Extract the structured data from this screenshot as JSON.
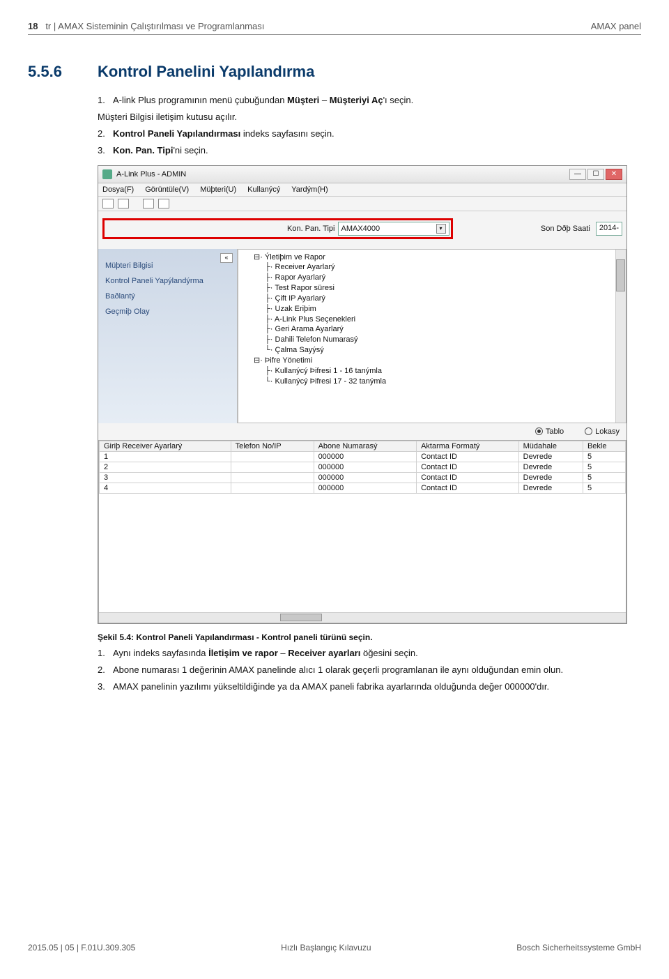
{
  "header": {
    "page_num": "18",
    "left_lang": "tr",
    "left_title": "AMAX Sisteminin Çalıştırılması ve Programlanması",
    "right": "AMAX panel"
  },
  "section": {
    "num": "5.5.6",
    "title": "Kontrol Panelini Yapılandırma",
    "steps_a": [
      {
        "n": "1.",
        "pre": "A-link Plus programının menü çubuğundan ",
        "bold": "Müşteri",
        "mid": " – ",
        "bold2": "Müşteriyi Aç",
        "post": "'ı seçin."
      },
      {
        "n": "",
        "pre": "Müşteri Bilgisi iletişim kutusu açılır.",
        "bold": "",
        "mid": "",
        "bold2": "",
        "post": ""
      },
      {
        "n": "2.",
        "pre": "",
        "bold": "Kontrol Paneli Yapılandırması",
        "mid": " indeks sayfasını seçin.",
        "bold2": "",
        "post": ""
      },
      {
        "n": "3.",
        "pre": "",
        "bold": "Kon. Pan. Tipi",
        "mid": "'ni seçin.",
        "bold2": "",
        "post": ""
      }
    ],
    "caption": "Şekil 5.4: Kontrol Paneli Yapılandırması - Kontrol paneli türünü seçin.",
    "steps_b": [
      {
        "n": "1.",
        "pre": "Aynı indeks sayfasında ",
        "bold": "İletişim ve rapor",
        "mid": " – ",
        "bold2": "Receiver ayarları",
        "post": " öğesini seçin."
      },
      {
        "n": "2.",
        "pre": "Abone numarası 1 değerinin AMAX panelinde alıcı 1 olarak geçerli programlanan ile aynı olduğundan emin olun.",
        "bold": "",
        "mid": "",
        "bold2": "",
        "post": ""
      },
      {
        "n": "3.",
        "pre": "AMAX panelinin yazılımı yükseltildiğinde ya da AMAX paneli fabrika ayarlarında olduğunda değer 000000'dır.",
        "bold": "",
        "mid": "",
        "bold2": "",
        "post": ""
      }
    ]
  },
  "app": {
    "title": "A-Link Plus - ADMIN",
    "menus": [
      "Dosya(F)",
      "Görüntüle(V)",
      "Müþteri(U)",
      "Kullanýcý",
      "Yardým(H)"
    ],
    "toprow": {
      "label": "Kon. Pan. Tipi",
      "combo_value": "AMAX4000",
      "right_label": "Son Dðþ Saati",
      "date": "2014-"
    },
    "sidebar": [
      "Müþteri Bilgisi",
      "Kontrol Paneli Yapýlandýrma",
      "Baðlantý",
      "Geçmiþ Olay"
    ],
    "tree": [
      {
        "lvl": 0,
        "prefix": "⊟·",
        "label": "Ýletiþim ve Rapor"
      },
      {
        "lvl": 1,
        "prefix": "├·",
        "label": "Receiver Ayarlarý"
      },
      {
        "lvl": 1,
        "prefix": "├·",
        "label": "Rapor Ayarlarý"
      },
      {
        "lvl": 1,
        "prefix": "├·",
        "label": "Test Rapor süresi"
      },
      {
        "lvl": 1,
        "prefix": "├·",
        "label": "Çift IP Ayarlarý"
      },
      {
        "lvl": 1,
        "prefix": "├·",
        "label": "Uzak Eriþim"
      },
      {
        "lvl": 1,
        "prefix": "├·",
        "label": "A-Link Plus Seçenekleri"
      },
      {
        "lvl": 1,
        "prefix": "├·",
        "label": "Geri Arama Ayarlarý"
      },
      {
        "lvl": 1,
        "prefix": "├·",
        "label": "Dahili Telefon Numarasý"
      },
      {
        "lvl": 1,
        "prefix": "└·",
        "label": "Çalma Sayýsý"
      },
      {
        "lvl": 0,
        "prefix": "⊟·",
        "label": "Þifre Yönetimi"
      },
      {
        "lvl": 1,
        "prefix": "├·",
        "label": "Kullanýcý Þifresi 1 - 16 tanýmla"
      },
      {
        "lvl": 1,
        "prefix": "└·",
        "label": "Kullanýcý Þifresi 17 - 32 tanýmla"
      }
    ],
    "radios": {
      "r1": "Tablo",
      "r2": "Lokasy"
    },
    "grid": {
      "headers": [
        "Giriþ Receiver Ayarlarý",
        "Telefon No/IP",
        "Abone Numarasý",
        "Aktarma Formatý",
        "Müdahale",
        "Bekle"
      ],
      "rows": [
        [
          "1",
          "",
          "000000",
          "Contact ID",
          "Devrede",
          "5"
        ],
        [
          "2",
          "",
          "000000",
          "Contact ID",
          "Devrede",
          "5"
        ],
        [
          "3",
          "",
          "000000",
          "Contact ID",
          "Devrede",
          "5"
        ],
        [
          "4",
          "",
          "000000",
          "Contact ID",
          "Devrede",
          "5"
        ]
      ]
    }
  },
  "footer": {
    "left": "2015.05 | 05 | F.01U.309.305",
    "center": "Hızlı Başlangıç Kılavuzu",
    "right": "Bosch Sicherheitssysteme GmbH"
  }
}
